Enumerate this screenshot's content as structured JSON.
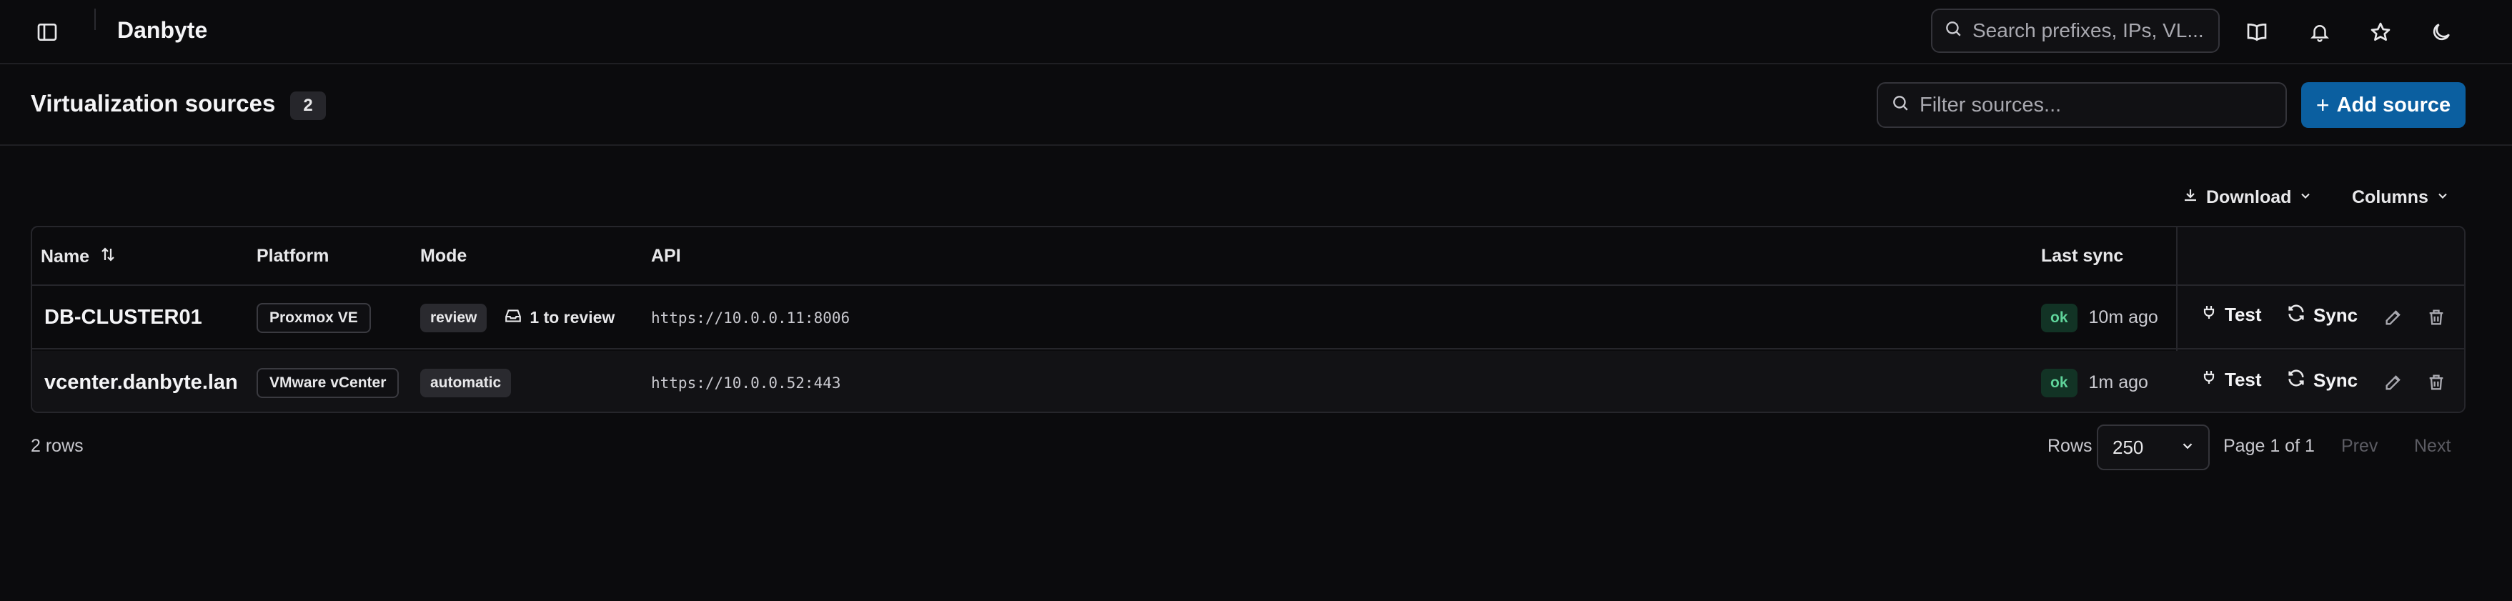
{
  "app": {
    "title": "Danbyte"
  },
  "global_search": {
    "placeholder": "Search prefixes, IPs, VL..."
  },
  "page": {
    "title": "Virtualization sources",
    "count": "2"
  },
  "filter": {
    "placeholder": "Filter sources..."
  },
  "add_button": {
    "label": "Add source"
  },
  "toolbar": {
    "download_label": "Download",
    "columns_label": "Columns"
  },
  "table": {
    "headers": {
      "name": "Name",
      "platform": "Platform",
      "mode": "Mode",
      "api": "API",
      "last_sync": "Last sync"
    },
    "rows": [
      {
        "name": "DB-CLUSTER01",
        "platform": "Proxmox VE",
        "mode": "review",
        "review_note": "1 to review",
        "api": "https://10.0.0.11:8006",
        "status": "ok",
        "last_sync": "10m ago",
        "test_label": "Test",
        "sync_label": "Sync"
      },
      {
        "name": "vcenter.danbyte.lan",
        "platform": "VMware vCenter",
        "mode": "automatic",
        "review_note": "",
        "api": "https://10.0.0.52:443",
        "status": "ok",
        "last_sync": "1m ago",
        "test_label": "Test",
        "sync_label": "Sync"
      }
    ]
  },
  "footer": {
    "row_count": "2 rows",
    "rows_label": "Rows",
    "rows_per_page": "250",
    "page_info": "Page 1 of 1",
    "prev_label": "Prev",
    "next_label": "Next"
  },
  "colors": {
    "accent": "#0b5fa0",
    "status_ok": "#5fd39a",
    "background": "#0b0b0d"
  }
}
